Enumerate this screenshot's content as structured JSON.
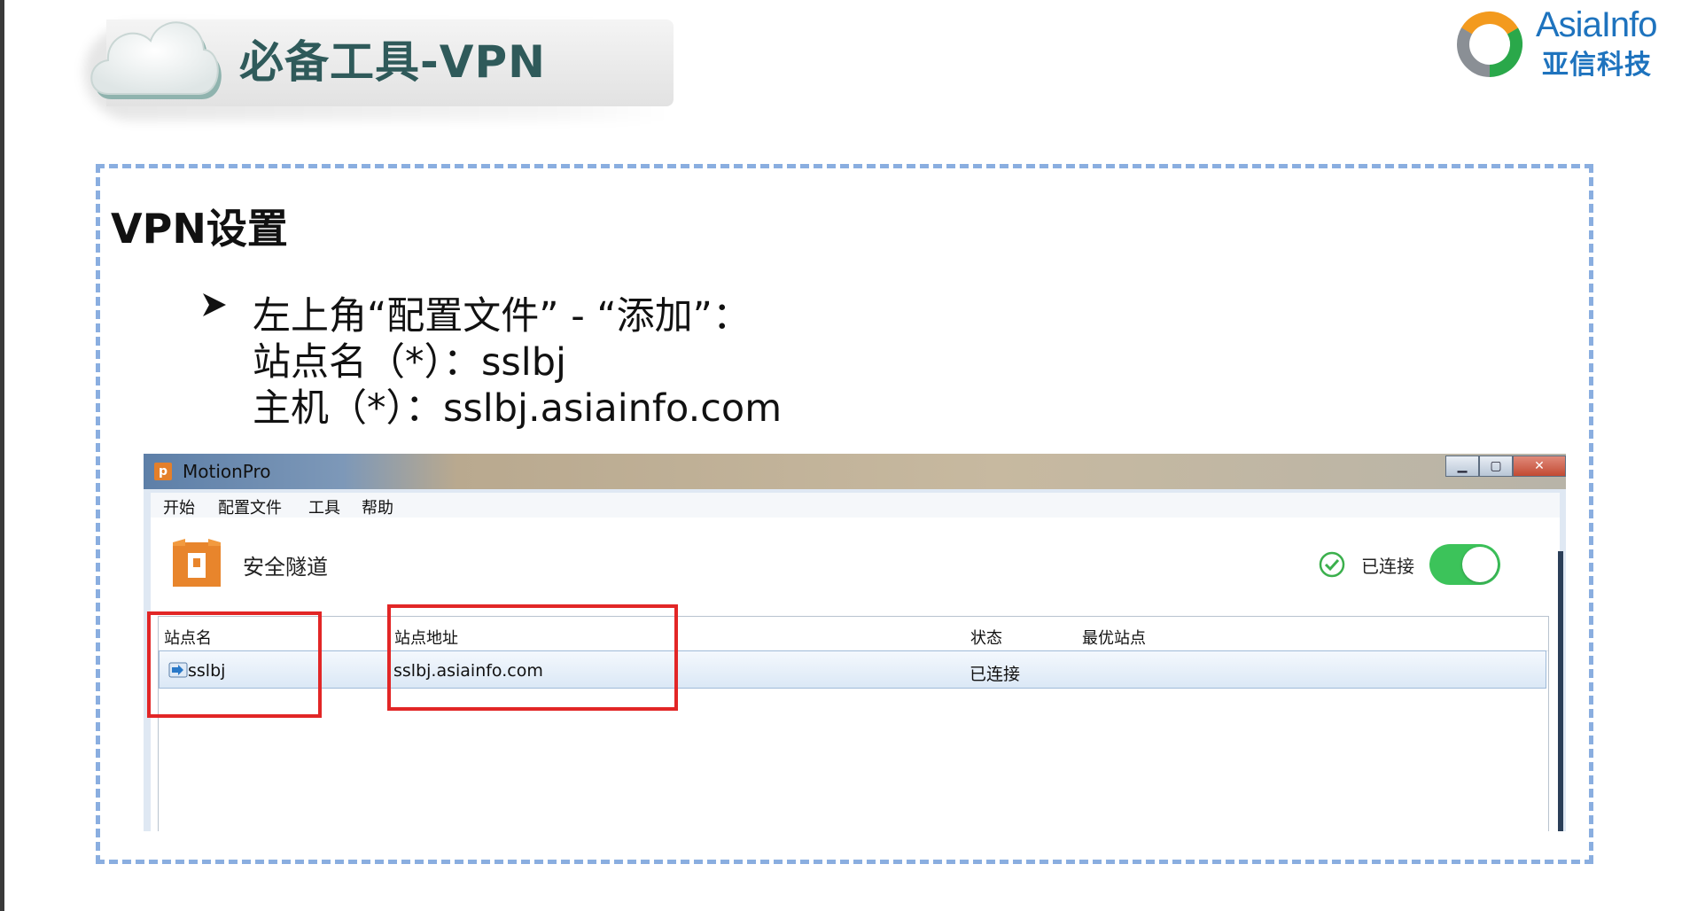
{
  "slide": {
    "title": "必备工具-VPN",
    "logo_en": "AsiaInfo",
    "logo_cn": "亚信科技",
    "section_title": "VPN设置",
    "lines": [
      "左上角“配置文件” - “添加”：",
      "站点名（*）：sslbj",
      "主机（*）：sslbj.asiainfo.com"
    ]
  },
  "app": {
    "window_title": "MotionPro",
    "menu": [
      "开始",
      "配置文件",
      "工具",
      "帮助"
    ],
    "brand_label": "安全隧道",
    "status_label": "已连接",
    "toggle_on": true,
    "table": {
      "columns": [
        "站点名",
        "站点地址",
        "状态",
        "最优站点"
      ],
      "rows": [
        {
          "site": "sslbj",
          "address": "sslbj.asiainfo.com",
          "status": "已连接",
          "best": ""
        }
      ]
    }
  },
  "colors": {
    "accent_green": "#3cc35a",
    "highlight_red": "#e22626",
    "frame_blue": "#8aaee0",
    "brand_orange": "#e47f2a",
    "logo_blue": "#1e73be"
  }
}
